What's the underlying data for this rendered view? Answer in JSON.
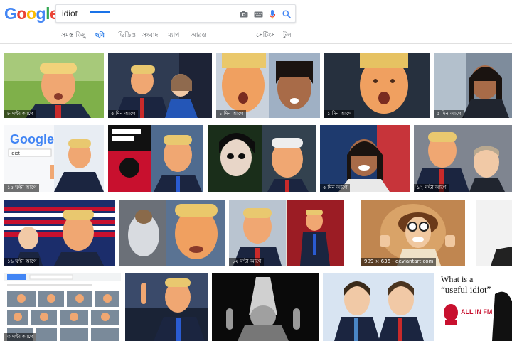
{
  "logo": {
    "g1": "G",
    "o1": "o",
    "o2": "o",
    "g2": "g",
    "l": "l",
    "e": "e"
  },
  "search": {
    "value": "idiot"
  },
  "tabs": {
    "all": "সমস্ত কিছু",
    "images": "ছবি",
    "videos": "ভিডিও",
    "news": "সংবাদ",
    "maps": "ম্যাপ",
    "more": "আরও",
    "settings": "সেটিংস",
    "tools": "টুল"
  },
  "tiles": {
    "t1": "৮ ঘণ্টা আগে",
    "t2": "৫ দিন আগে",
    "t3": "১ দিন আগে",
    "t4": "১ দিন আগে",
    "t5": "৫ দিন আগে",
    "t6": "১৫ ঘণ্টা আগে",
    "t9": "৫ দিন আগে",
    "t10": "১২ ঘণ্টা আগে",
    "t11": "১৬ ঘণ্টা আগে",
    "t13": "১২ ঘণ্টা আগে",
    "t14": "909 × 636 - deviantart.com",
    "t16": "৩ ঘণ্টা আগে",
    "t20a": "What is a",
    "t20b": "“useful idiot”",
    "t20c": "ALL IN FM",
    "mini_logo": "Google",
    "mini_query": "idiot"
  },
  "colors": {
    "accent": "#1a73e8",
    "border": "#dfe1e5"
  }
}
